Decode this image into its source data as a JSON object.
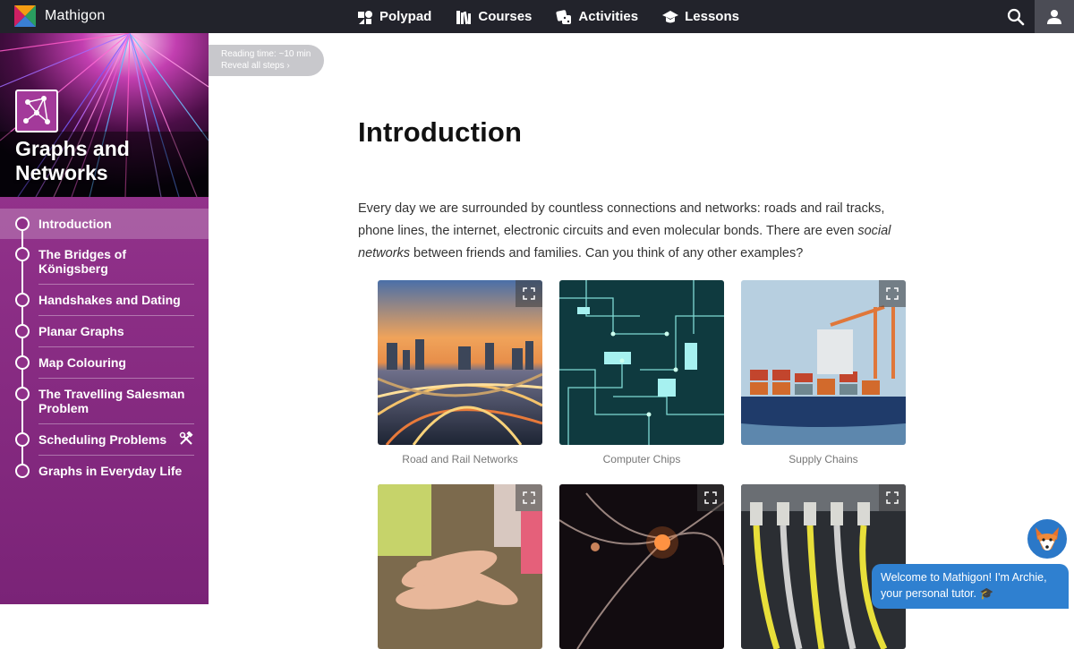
{
  "topbar": {
    "brand": "Mathigon",
    "nav": [
      {
        "label": "Polypad",
        "icon": "polypad-icon"
      },
      {
        "label": "Courses",
        "icon": "books-icon"
      },
      {
        "label": "Activities",
        "icon": "dice-icon"
      },
      {
        "label": "Lessons",
        "icon": "graduation-cap-icon"
      }
    ]
  },
  "sidebar": {
    "course_title": "Graphs and Networks",
    "items": [
      {
        "label": "Introduction"
      },
      {
        "label": "The Bridges of Königsberg"
      },
      {
        "label": "Handshakes and Dating"
      },
      {
        "label": "Planar Graphs"
      },
      {
        "label": "Map Colouring"
      },
      {
        "label": "The Travelling Salesman Problem"
      },
      {
        "label": "Scheduling Problems"
      },
      {
        "label": "Graphs in Everyday Life"
      }
    ]
  },
  "reading": {
    "time": "Reading time: ~10 min",
    "reveal": "Reveal all steps ›"
  },
  "main": {
    "title": "Introduction",
    "intro_before": "Every day we are surrounded by countless connections and networks: roads and rail tracks, phone lines, the internet, electronic circuits and even molecular bonds. There are even ",
    "intro_em": "social networks",
    "intro_after": " between friends and families. Can you think of any other examples?",
    "gallery": [
      {
        "caption": "Road and Rail Networks"
      },
      {
        "caption": "Computer Chips"
      },
      {
        "caption": "Supply Chains"
      },
      {
        "caption": ""
      },
      {
        "caption": ""
      },
      {
        "caption": ""
      }
    ]
  },
  "tutor": {
    "message_line1": "Welcome to Mathigon! I'm Archie,",
    "message_line2": "your personal tutor. 🎓"
  }
}
